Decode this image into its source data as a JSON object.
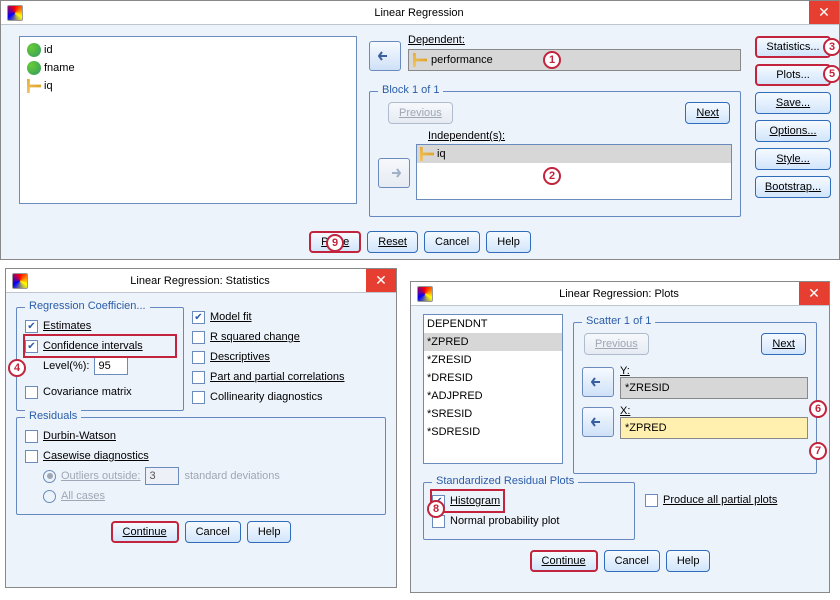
{
  "main": {
    "title": "Linear Regression",
    "vars": [
      "id",
      "fname",
      "iq"
    ],
    "dep_label": "Dependent:",
    "dep_value": "performance",
    "block_label": "Block 1 of 1",
    "prev": "Previous",
    "next": "Next",
    "indep_label": "Independent(s):",
    "indep_value": "iq",
    "buttons": {
      "paste": "Paste",
      "reset": "Reset",
      "cancel": "Cancel",
      "help": "Help"
    },
    "side": {
      "stats": "Statistics...",
      "plots": "Plots...",
      "save": "Save...",
      "options": "Options...",
      "style": "Style...",
      "bootstrap": "Bootstrap..."
    }
  },
  "stats": {
    "title": "Linear Regression: Statistics",
    "coef_legend": "Regression Coefficien...",
    "estimates": "Estimates",
    "ci": "Confidence intervals",
    "level": "Level(%):",
    "level_val": "95",
    "cov": "Covariance matrix",
    "modelfit": "Model fit",
    "r2": "R squared change",
    "desc": "Descriptives",
    "partcorr": "Part and partial correlations",
    "collin": "Collinearity diagnostics",
    "resid_legend": "Residuals",
    "dw": "Durbin-Watson",
    "casewise": "Casewise diagnostics",
    "outliers": "Outliers outside:",
    "outliers_val": "3",
    "stddev": "standard deviations",
    "allcases": "All cases",
    "continue": "Continue",
    "cancel": "Cancel",
    "help": "Help"
  },
  "plots": {
    "title": "Linear Regression: Plots",
    "vars": [
      "DEPENDNT",
      "*ZPRED",
      "*ZRESID",
      "*DRESID",
      "*ADJPRED",
      "*SRESID",
      "*SDRESID"
    ],
    "scatter_legend": "Scatter 1 of 1",
    "prev": "Previous",
    "next": "Next",
    "y_label": "Y:",
    "y_val": "*ZRESID",
    "x_label": "X:",
    "x_val": "*ZPRED",
    "srp_legend": "Standardized Residual Plots",
    "hist": "Histogram",
    "npp": "Normal probability plot",
    "partial": "Produce all partial plots",
    "continue": "Continue",
    "cancel": "Cancel",
    "help": "Help"
  },
  "badges": {
    "1": "1",
    "2": "2",
    "3": "3",
    "4": "4",
    "5": "5",
    "6": "6",
    "7": "7",
    "8": "8",
    "9": "9"
  }
}
